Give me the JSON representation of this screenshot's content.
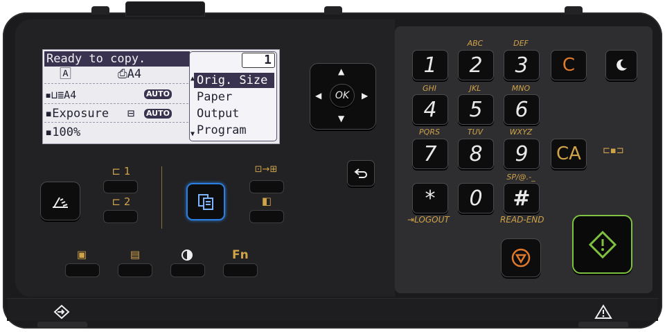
{
  "lcd": {
    "status": "Ready to copy.",
    "copies": "1",
    "row_original_size": "A4",
    "row_paper_size": "A4",
    "row_exposure": "Exposure",
    "row_zoom": "100%",
    "auto_badge": "AUTO",
    "menu": [
      "Orig. Size",
      "Paper",
      "Output",
      "Program"
    ]
  },
  "nav": {
    "ok": "OK"
  },
  "left_buttons": {
    "tray1": "1",
    "tray2": "2",
    "fn": "Fn"
  },
  "keypad": {
    "keys": [
      "1",
      "2",
      "3",
      "4",
      "5",
      "6",
      "7",
      "8",
      "9",
      "*",
      "0",
      "#"
    ],
    "sublabels": {
      "2": "ABC",
      "3": "DEF",
      "4": "GHI",
      "5": "JKL",
      "6": "MNO",
      "7": "PQRS",
      "8": "TUV",
      "9": "WXYZ",
      "#": "SP/@.-_"
    },
    "clear": "C",
    "clear_all": "CA",
    "logout": "LOGOUT",
    "read_end": "READ-END"
  },
  "colors": {
    "accent_gold": "#d0a34a",
    "clear_orange": "#e07a2a",
    "start_green": "#7fc241",
    "copy_blue": "#2b7fe0",
    "lcd_highlight": "#3a3350"
  },
  "icons": [
    "scan-icon",
    "copy-icon",
    "sleep-icon",
    "back-icon",
    "stop-icon",
    "start-icon",
    "data-in-icon",
    "warning-icon",
    "logout-icon",
    "contrast-icon"
  ]
}
